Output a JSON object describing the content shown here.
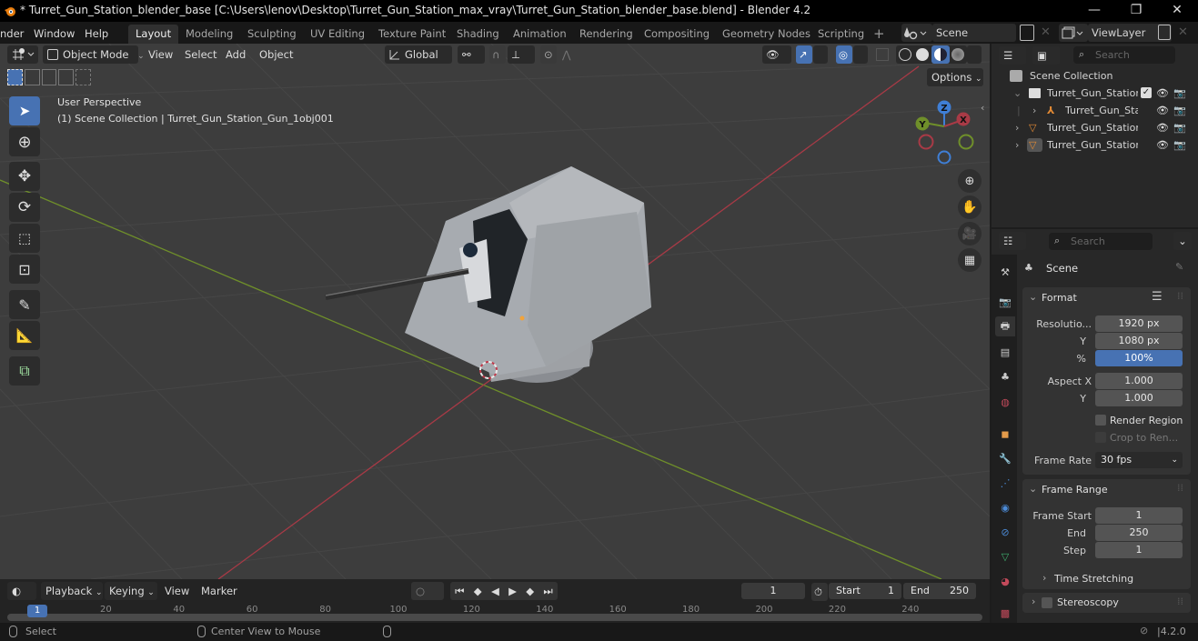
{
  "window": {
    "title": "* Turret_Gun_Station_blender_base [C:\\Users\\lenov\\Desktop\\Turret_Gun_Station_max_vray\\Turret_Gun_Station_blender_base.blend] - Blender 4.2",
    "controls": {
      "minimize": "—",
      "maximize": "❐",
      "close": "✕"
    }
  },
  "menu": {
    "items": [
      "nder",
      "Window",
      "Help"
    ],
    "workspaces": [
      "Layout",
      "Modeling",
      "Sculpting",
      "UV Editing",
      "Texture Paint",
      "Shading",
      "Animation",
      "Rendering",
      "Compositing",
      "Geometry Nodes",
      "Scripting"
    ],
    "active_workspace": "Layout",
    "add_workspace": "+",
    "scene": "Scene",
    "view_layer": "ViewLayer"
  },
  "viewport": {
    "mode": "Object Mode",
    "menus": [
      "View",
      "Select",
      "Add",
      "Object"
    ],
    "orientation": "Global",
    "options_label": "Options",
    "overlay_title": "User Perspective",
    "overlay_context": "(1) Scene Collection | Turret_Gun_Station_Gun_1obj001",
    "gizmo_axes": {
      "x": "X",
      "y": "Y",
      "z": "Z"
    },
    "colors": {
      "x_axis": "#a83a46",
      "y_axis": "#6f8f2a",
      "z_axis": "#3f7fd6",
      "accent": "#4772b3"
    }
  },
  "outliner": {
    "search_placeholder": "Search",
    "root": "Scene Collection",
    "rows": [
      {
        "label": "Turret_Gun_Station",
        "type": "collection",
        "checked": true
      },
      {
        "label": "Turret_Gun_Sta",
        "type": "empty"
      },
      {
        "label": "Turret_Gun_Station",
        "type": "mesh"
      },
      {
        "label": "Turret_Gun_Station",
        "type": "mesh"
      }
    ]
  },
  "properties": {
    "search_placeholder": "Search",
    "context": "Scene",
    "format": {
      "title": "Format",
      "resolution_x_label": "Resolutio...",
      "resolution_x": "1920 px",
      "resolution_y_label": "Y",
      "resolution_y": "1080 px",
      "percent_label": "%",
      "percent": "100%",
      "aspect_x_label": "Aspect X",
      "aspect_x": "1.000",
      "aspect_y_label": "Y",
      "aspect_y": "1.000",
      "render_region": "Render Region",
      "crop": "Crop to Ren...",
      "frame_rate_label": "Frame Rate",
      "frame_rate": "30 fps"
    },
    "frame_range": {
      "title": "Frame Range",
      "start_label": "Frame Start",
      "start": "1",
      "end_label": "End",
      "end": "250",
      "step_label": "Step",
      "step": "1",
      "time_stretching": "Time Stretching"
    },
    "stereoscopy": "Stereoscopy"
  },
  "timeline": {
    "menus": [
      "Playback",
      "Keying",
      "View",
      "Marker"
    ],
    "current_frame": "1",
    "start_label": "Start",
    "start": "1",
    "end_label": "End",
    "end": "250",
    "ticks": [
      "20",
      "40",
      "60",
      "80",
      "100",
      "120",
      "140",
      "160",
      "180",
      "200",
      "220",
      "240"
    ],
    "playhead": "1"
  },
  "statusbar": {
    "left": "Select",
    "middle": "Center View to Mouse",
    "version": "4.2.0"
  }
}
